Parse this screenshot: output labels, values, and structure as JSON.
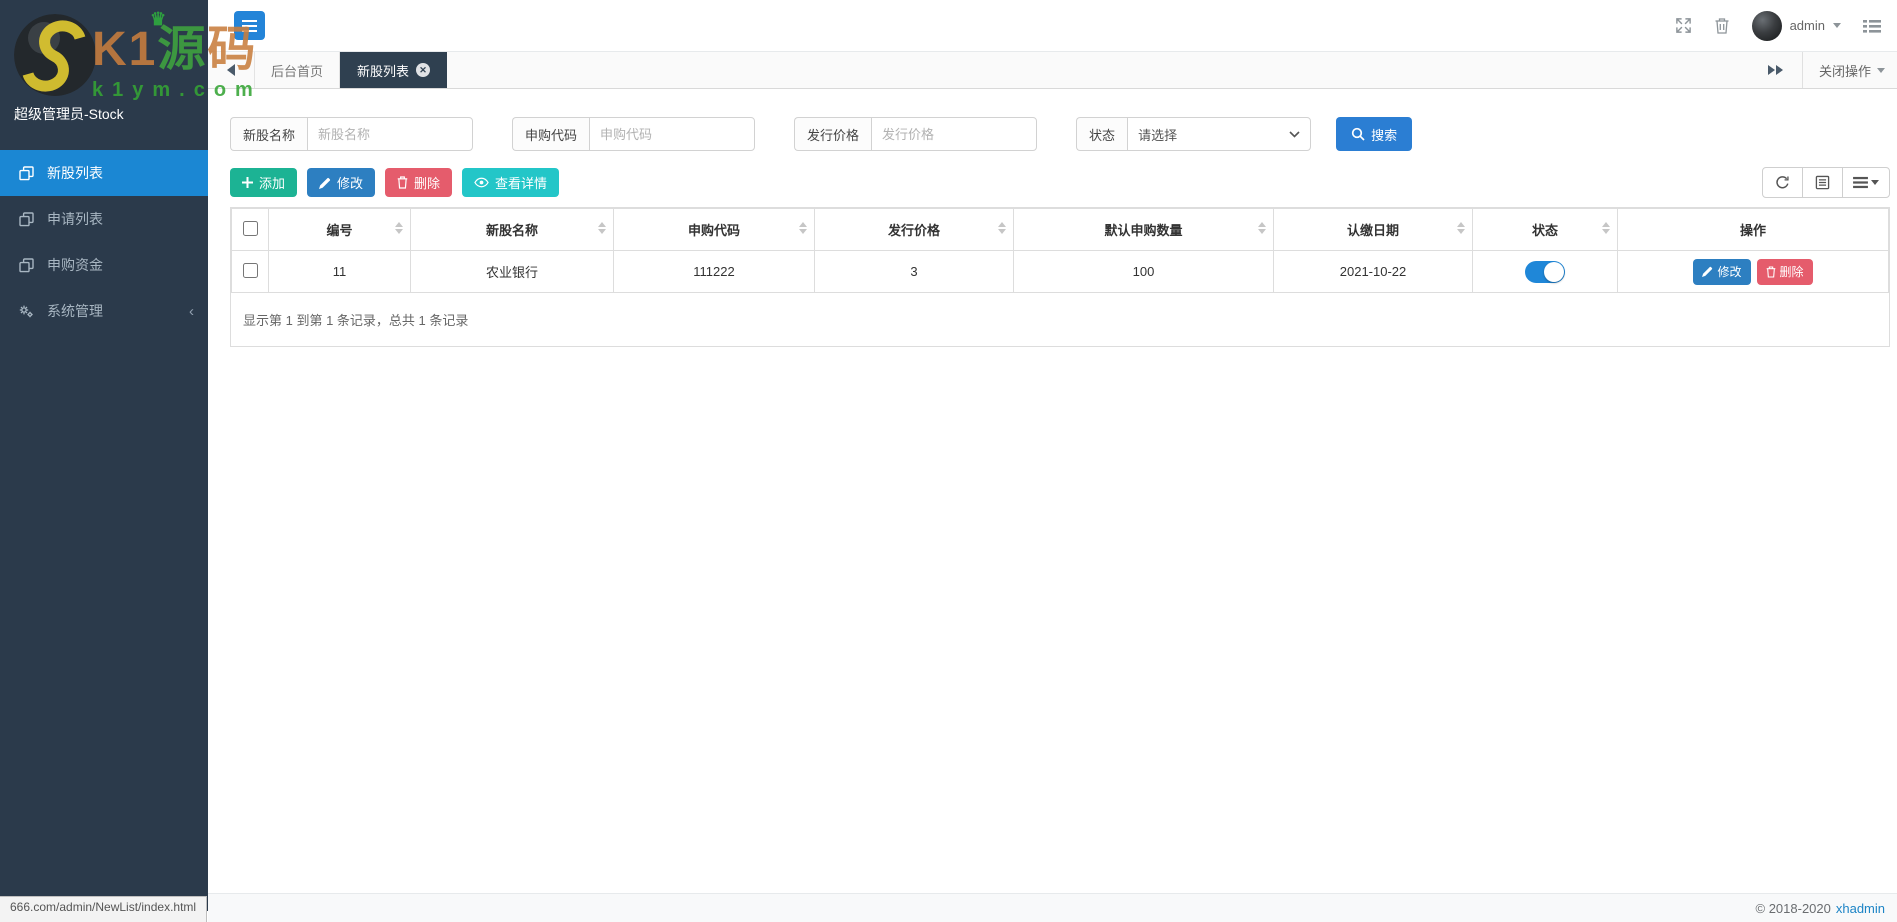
{
  "watermark": {
    "part_k1": "K1",
    "part_yuan": "源",
    "part_ma": "码",
    "subtitle": "k1ym.com",
    "crown": "♛"
  },
  "sidebar": {
    "profile_name": "超级管理员-Stock",
    "items": [
      {
        "label": "新股列表",
        "icon": "clone-icon",
        "active": true
      },
      {
        "label": "申请列表",
        "icon": "clone-icon",
        "active": false
      },
      {
        "label": "申购资金",
        "icon": "clone-icon",
        "active": false
      },
      {
        "label": "系统管理",
        "icon": "gears-icon",
        "active": false,
        "collapsed": true
      }
    ]
  },
  "topbar": {
    "username": "admin"
  },
  "tabs": {
    "items": [
      {
        "label": "后台首页",
        "active": false,
        "closable": false
      },
      {
        "label": "新股列表",
        "active": true,
        "closable": true
      }
    ],
    "close_icon": "✕",
    "close_ops_label": "关闭操作"
  },
  "filters": [
    {
      "label": "新股名称",
      "placeholder": "新股名称"
    },
    {
      "label": "申购代码",
      "placeholder": "申购代码"
    },
    {
      "label": "发行价格",
      "placeholder": "发行价格"
    },
    {
      "label": "状态",
      "value": "请选择"
    }
  ],
  "search": {
    "label": "搜索"
  },
  "actions": {
    "add": "添加",
    "edit": "修改",
    "delete": "删除",
    "detail": "查看详情"
  },
  "table": {
    "columns": [
      "编号",
      "新股名称",
      "申购代码",
      "发行价格",
      "默认申购数量",
      "认缴日期",
      "状态",
      "操作"
    ],
    "rows": [
      {
        "id": "11",
        "name": "农业银行",
        "code": "111222",
        "price": "3",
        "qty": "100",
        "date": "2021-10-22",
        "status_on": true
      }
    ],
    "row_actions": {
      "edit": "修改",
      "delete": "删除"
    },
    "summary": "显示第 1 到第 1 条记录，总共 1 条记录"
  },
  "footer": {
    "copyright": "© 2018-2020",
    "brand": "xhadmin"
  },
  "statusbar": {
    "text": "666.com/admin/NewList/index.html"
  },
  "colors": {
    "primary": "#2384d8",
    "sidebar_bg": "#2b3a4b",
    "sidebar_active": "#1b87d3",
    "tab_active_bg": "#2f4050",
    "add_green": "#1cb394",
    "edit_blue": "#2d7fc1",
    "delete_red": "#e55c6c",
    "detail_teal": "#23c6c8",
    "toggle_blue": "#1f87d8",
    "link_blue": "#1c84c6"
  }
}
